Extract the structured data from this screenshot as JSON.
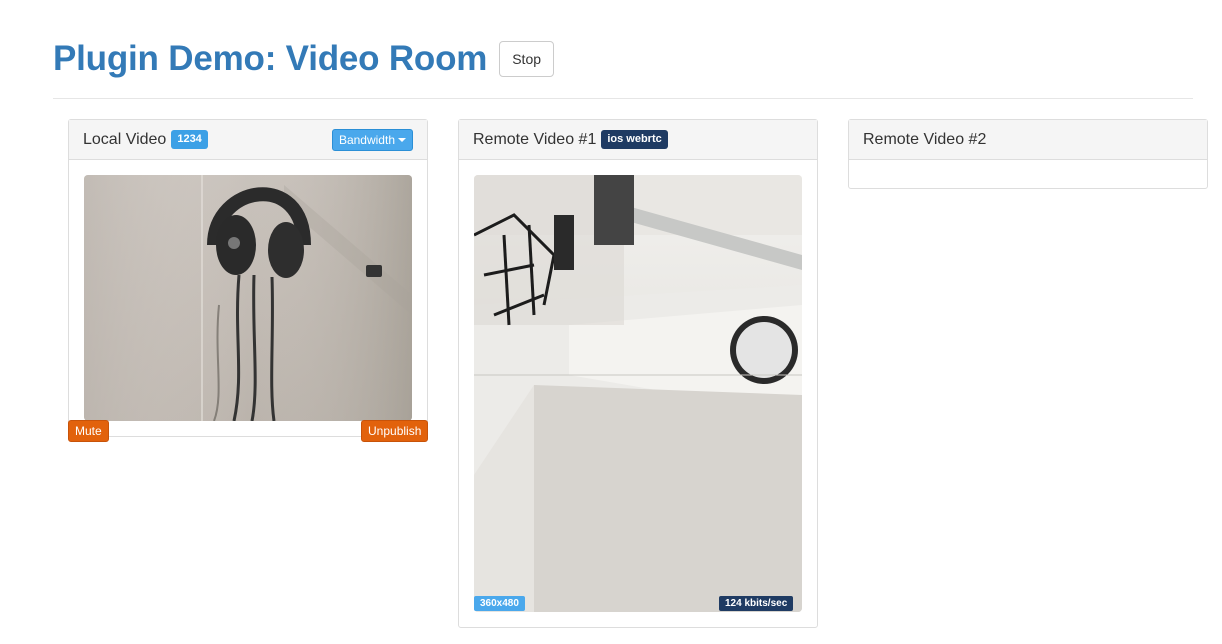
{
  "header": {
    "title": "Plugin Demo: Video Room",
    "stop_label": "Stop"
  },
  "local": {
    "title": "Local Video",
    "id_badge": "1234",
    "bandwidth_label": "Bandwidth",
    "mute_label": "Mute",
    "unpublish_label": "Unpublish"
  },
  "remote1": {
    "title": "Remote Video #1",
    "name_badge": "ios webrtc",
    "resolution": "360x480",
    "bitrate": "124 kbits/sec"
  },
  "remote2": {
    "title": "Remote Video #2"
  },
  "colors": {
    "title": "#337ab7",
    "info": "#3ca0e6",
    "primary": "#1f3b63",
    "warning": "#e2620c"
  }
}
